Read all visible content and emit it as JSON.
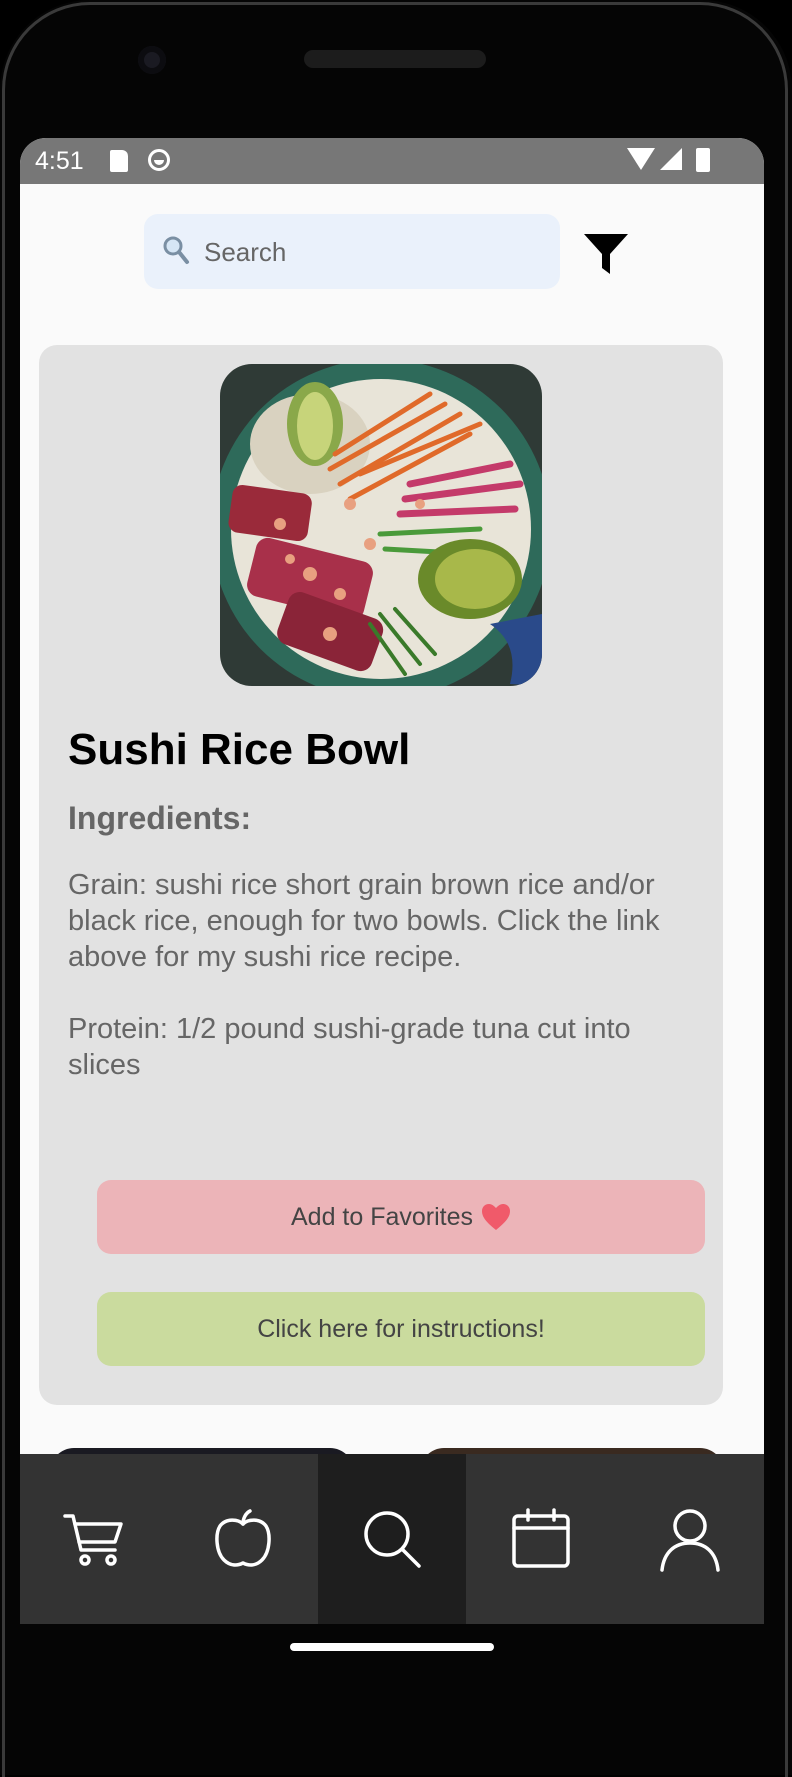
{
  "status_bar": {
    "time": "4:51"
  },
  "search": {
    "placeholder": "Search"
  },
  "recipe": {
    "title": "Sushi Rice Bowl",
    "ingredients_heading": "Ingredients:",
    "ingredients": [
      "Grain: sushi rice short grain brown rice and/or black rice, enough for two bowls. Click the link above for my sushi rice recipe.",
      "Protein: 1/2 pound sushi-grade tuna cut into slices"
    ],
    "favorites_label": "Add to Favorites",
    "instructions_label": "Click here for instructions!"
  },
  "bottom_nav": {
    "items": [
      {
        "icon": "cart-icon"
      },
      {
        "icon": "apple-icon"
      },
      {
        "icon": "search-icon",
        "active": true
      },
      {
        "icon": "calendar-icon"
      },
      {
        "icon": "profile-icon"
      }
    ]
  },
  "colors": {
    "favorites_button": "#ecb4b8",
    "instructions_button": "#cadb9e",
    "card_background": "#e2e2e2",
    "search_background": "#eaf1fb",
    "nav_background": "#333333",
    "nav_active": "#1e1e1e"
  }
}
